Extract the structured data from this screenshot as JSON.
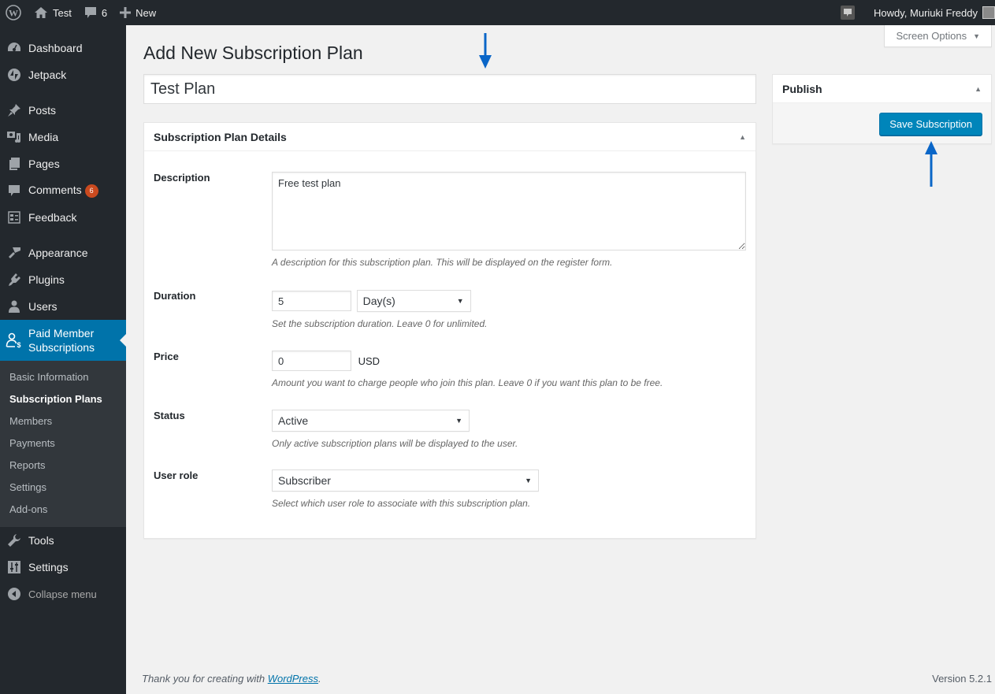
{
  "adminbar": {
    "site_name": "Test",
    "comments_count": "6",
    "new_label": "New",
    "greeting": "Howdy, Muriuki Freddy",
    "icons": [
      "wordpress-logo-icon",
      "home-icon",
      "comment-icon",
      "plus-icon",
      "notification-icon"
    ]
  },
  "sidebar": {
    "items": [
      {
        "label": "Dashboard",
        "icon": "dashboard-icon"
      },
      {
        "label": "Jetpack",
        "icon": "jetpack-icon"
      },
      {
        "label": "Posts",
        "icon": "pin-icon"
      },
      {
        "label": "Media",
        "icon": "media-icon"
      },
      {
        "label": "Pages",
        "icon": "pages-icon"
      },
      {
        "label": "Comments",
        "icon": "comment-icon",
        "badge": "6"
      },
      {
        "label": "Feedback",
        "icon": "feedback-icon"
      },
      {
        "label": "Appearance",
        "icon": "brush-icon"
      },
      {
        "label": "Plugins",
        "icon": "plug-icon"
      },
      {
        "label": "Users",
        "icon": "user-icon"
      },
      {
        "label": "Paid Member Subscriptions",
        "icon": "member-dollar-icon"
      },
      {
        "label": "Tools",
        "icon": "wrench-icon"
      },
      {
        "label": "Settings",
        "icon": "sliders-icon"
      }
    ],
    "submenu": [
      "Basic Information",
      "Subscription Plans",
      "Members",
      "Payments",
      "Reports",
      "Settings",
      "Add-ons"
    ],
    "submenu_current": "Subscription Plans",
    "collapse_label": "Collapse menu",
    "accent_color": "#0073aa"
  },
  "screen_options": "Screen Options",
  "page": {
    "title": "Add New Subscription Plan",
    "plan_name": "Test Plan"
  },
  "details": {
    "heading": "Subscription Plan Details",
    "description": {
      "label": "Description",
      "value": "Free test plan",
      "help": "A description for this subscription plan. This will be displayed on the register form."
    },
    "duration": {
      "label": "Duration",
      "value": "5",
      "unit": "Day(s)",
      "help": "Set the subscription duration. Leave 0 for unlimited."
    },
    "price": {
      "label": "Price",
      "value": "0",
      "currency": "USD",
      "help": "Amount you want to charge people who join this plan. Leave 0 if you want this plan to be free."
    },
    "status": {
      "label": "Status",
      "value": "Active",
      "help": "Only active subscription plans will be displayed to the user."
    },
    "user_role": {
      "label": "User role",
      "value": "Subscriber",
      "help": "Select which user role to associate with this subscription plan."
    }
  },
  "publish": {
    "heading": "Publish",
    "save_label": "Save Subscription",
    "button_color": "#0085ba"
  },
  "annotation_color": "#0a66c8",
  "footer": {
    "thanks_prefix": "Thank you for creating with ",
    "thanks_link": "WordPress",
    "thanks_suffix": ".",
    "version": "Version 5.2.1"
  }
}
